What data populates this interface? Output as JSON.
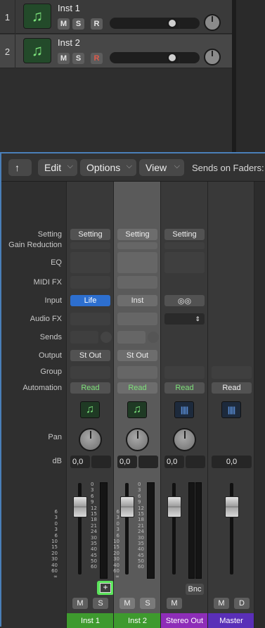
{
  "tracks": [
    {
      "number": "1",
      "name": "Inst 1",
      "mute": "M",
      "solo": "S",
      "record": "R",
      "record_armed": false
    },
    {
      "number": "2",
      "name": "Inst 2",
      "mute": "M",
      "solo": "S",
      "record": "R",
      "record_armed": true
    }
  ],
  "mixer": {
    "back_icon": "back-arrow-icon",
    "menus": [
      "Edit",
      "Options",
      "View"
    ],
    "sends_on_faders": "Sends on Faders:",
    "row_labels": {
      "setting": "Setting",
      "gain_reduction": "Gain Reduction",
      "eq": "EQ",
      "midi_fx": "MIDI FX",
      "input": "Input",
      "audio_fx": "Audio FX",
      "sends": "Sends",
      "output": "Output",
      "group": "Group",
      "automation": "Automation",
      "pan": "Pan",
      "db": "dB"
    },
    "strips": [
      {
        "name": "Inst 1",
        "setting": "Setting",
        "input": "Life",
        "output": "St Out",
        "automation": "Read",
        "db_left": "0,0",
        "mute": "M",
        "solo": "S",
        "color": "#3e9a2e"
      },
      {
        "name": "Inst 2",
        "setting": "Setting",
        "input": "Inst",
        "output": "St Out",
        "automation": "Read",
        "db_left": "0,0",
        "mute": "M",
        "solo": "S",
        "color": "#3e9a2e"
      },
      {
        "name": "Stereo Out",
        "setting": "Setting",
        "input_icon": "stereo-link-icon",
        "automation": "Read",
        "db_left": "0,0",
        "mute": "M",
        "bounce": "Bnc",
        "color": "#8e2db8"
      },
      {
        "name": "Master",
        "automation": "Read",
        "db_left": "0,0",
        "mute": "M",
        "dim": "D",
        "color": "#5a2fb8"
      }
    ],
    "fader_scale": [
      "6",
      "3",
      "0",
      "3",
      "6",
      "10",
      "15",
      "20",
      "30",
      "40",
      "60",
      "∞"
    ],
    "meter_scale": [
      "0",
      "3",
      "6",
      "9",
      "12",
      "15",
      "18",
      "21",
      "24",
      "30",
      "35",
      "40",
      "45",
      "50",
      "60"
    ]
  }
}
